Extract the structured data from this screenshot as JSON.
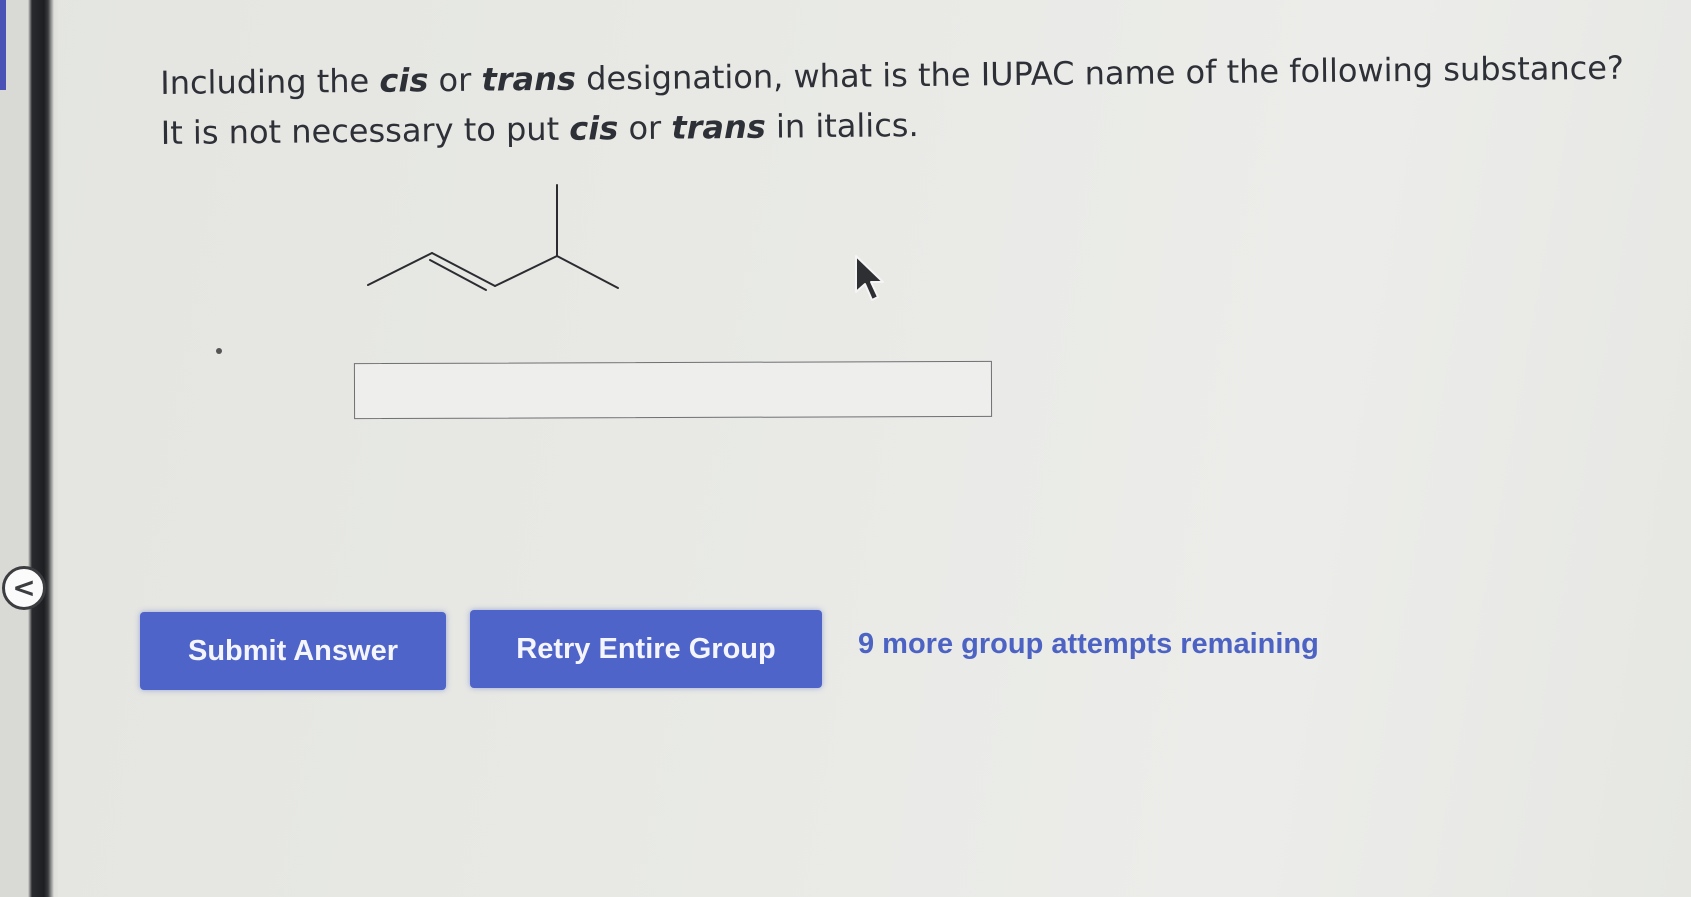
{
  "question": {
    "line1_pre": "Including the ",
    "line1_cis": "cis",
    "line1_mid": " or ",
    "line1_trans": "trans",
    "line1_post": " designation, what is the IUPAC name of the following substance?",
    "line2_pre": "It is not necessary to put ",
    "line2_cis": "cis",
    "line2_mid": " or ",
    "line2_trans": "trans",
    "line2_post": " in italics."
  },
  "answer": {
    "value": "",
    "placeholder": ""
  },
  "buttons": {
    "submit_label": "Submit Answer",
    "retry_label": "Retry Entire Group"
  },
  "status": {
    "attempts_text": "9 more group attempts remaining"
  },
  "sidebar": {
    "collapse_glyph": "<"
  },
  "colors": {
    "button_bg": "#4e64c8",
    "accent_text": "#4d63c4",
    "question_text": "#2e3037"
  },
  "icons": {
    "cursor": "mouse-pointer-icon",
    "collapse": "chevron-left-icon"
  }
}
